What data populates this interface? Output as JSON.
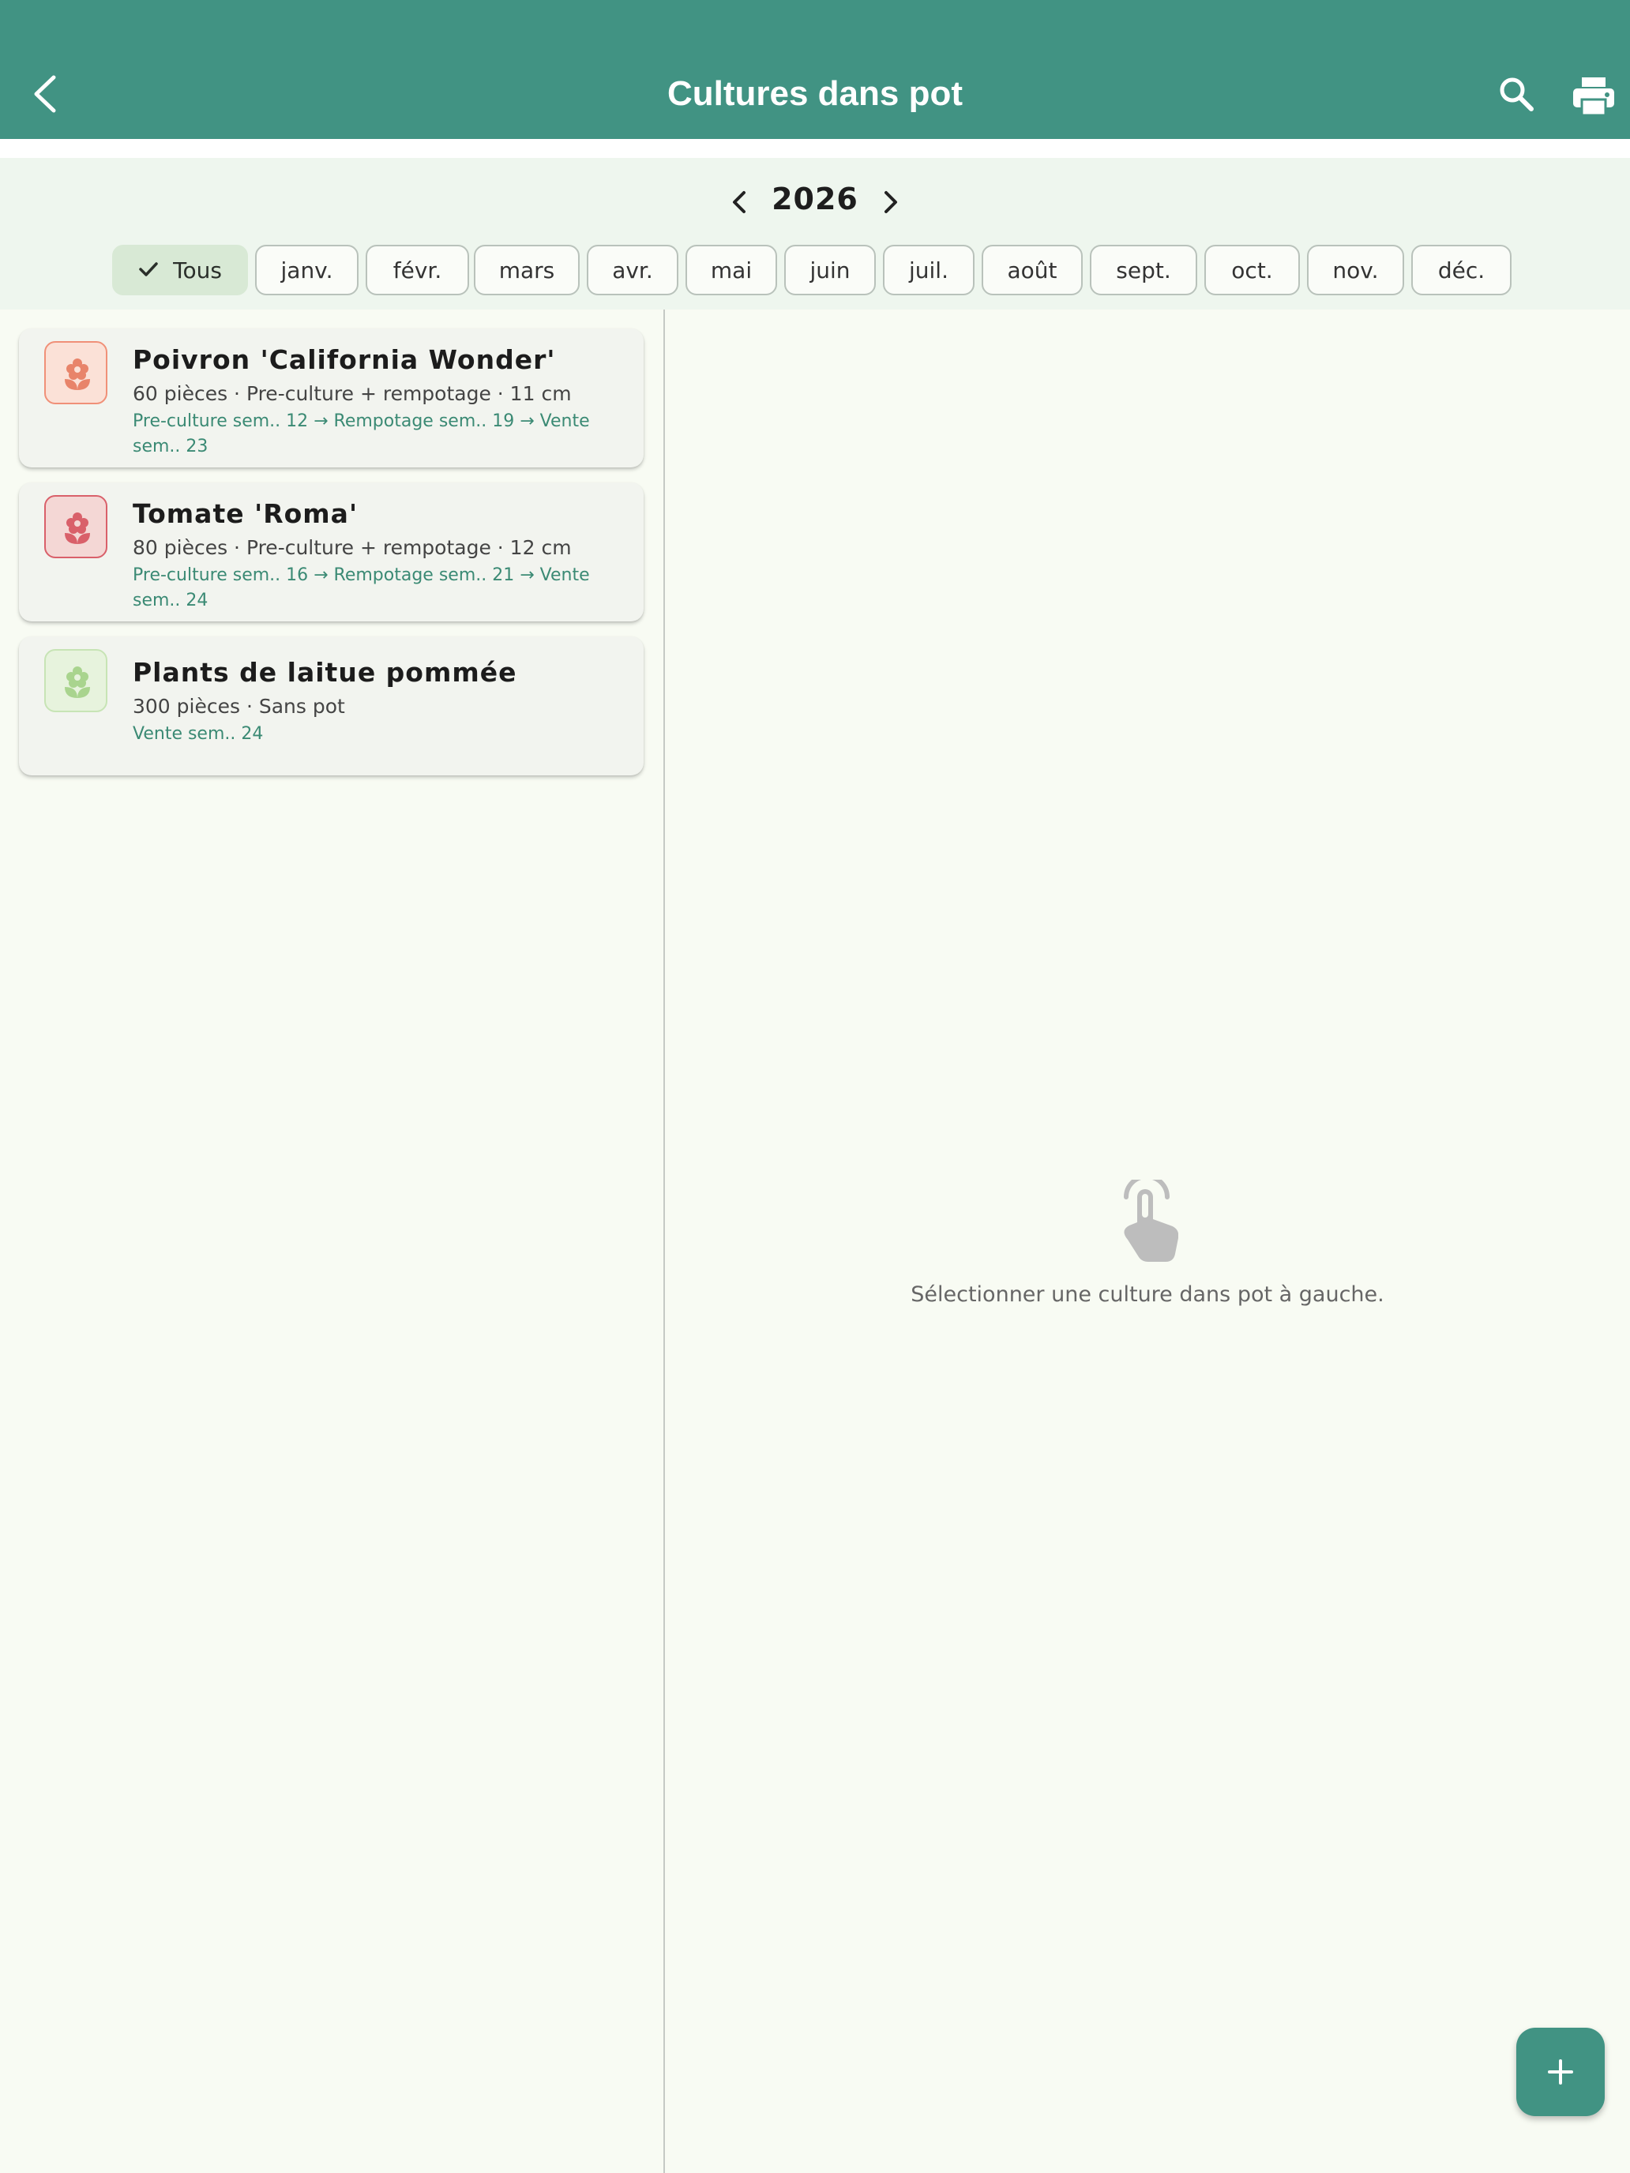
{
  "appbar": {
    "title": "Cultures dans pot",
    "icons": [
      "back-icon",
      "search-icon",
      "print-icon"
    ]
  },
  "year_nav": {
    "year": "2026"
  },
  "month_filter": {
    "selected": "Tous",
    "options": [
      "Tous",
      "janv.",
      "févr.",
      "mars",
      "avr.",
      "mai",
      "juin",
      "juil.",
      "août",
      "sept.",
      "oct.",
      "nov.",
      "déc."
    ]
  },
  "cultures": [
    {
      "name": "Poivron 'California Wonder'",
      "meta": "60 pièces · Pre-culture + rempotage · 11 cm",
      "schedule": "Pre-culture sem.. 12 → Rempotage sem.. 19 → Vente sem.. 23",
      "icon": "flower-icon",
      "color": "#e8846a"
    },
    {
      "name": "Tomate 'Roma'",
      "meta": "80 pièces · Pre-culture + rempotage · 12 cm",
      "schedule": "Pre-culture sem.. 16 → Rempotage sem.. 21 → Vente sem.. 24",
      "icon": "flower-icon",
      "color": "#d9606a"
    },
    {
      "name": "Plants de laitue pommée",
      "meta": "300 pièces · Sans pot",
      "schedule": "Vente sem.. 24",
      "icon": "flower-icon",
      "color": "#a9d48e"
    }
  ],
  "detail_panel": {
    "empty_message": "Sélectionner une culture dans pot à gauche.",
    "icon": "touch-icon"
  },
  "fab": {
    "icon": "plus-icon"
  },
  "colors": {
    "primary": "#419383",
    "background": "#f8fbf3",
    "chip_selected": "#d8e9d5",
    "schedule_text": "#3b8a74"
  }
}
